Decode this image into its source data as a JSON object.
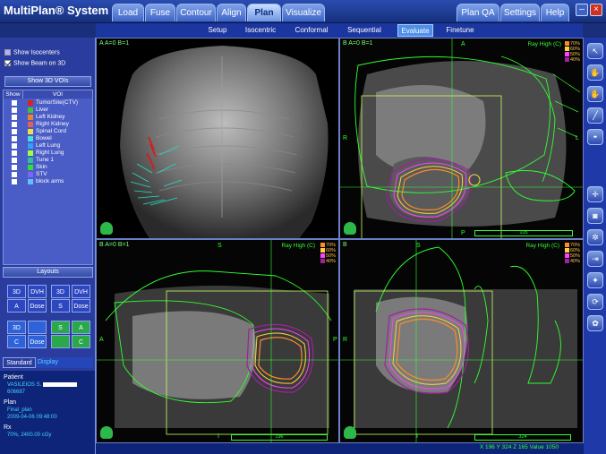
{
  "app": {
    "title": "MultiPlan® System"
  },
  "main_tabs": [
    "Load",
    "Fuse",
    "Contour",
    "Align",
    "Plan",
    "Visualize"
  ],
  "right_tabs": [
    "Plan QA",
    "Settings",
    "Help"
  ],
  "active_main_tab": "Plan",
  "sub_tabs": [
    "Setup",
    "Isocentric",
    "Conformal",
    "Sequential",
    "Evaluate",
    "Finetune"
  ],
  "active_sub_tab": "Evaluate",
  "left_panel": {
    "show_isocenters": "Show Isocenters",
    "show_beam_3d": "Show Beam on 3D",
    "show_3d_vois": "Show 3D VOIs",
    "voi_header_show": "Show",
    "voi_header_voi": "VOI",
    "vois": [
      {
        "name": "TumorSite(CTV)",
        "color": "#e02020"
      },
      {
        "name": "Liver",
        "color": "#40c040"
      },
      {
        "name": "Left Kidney",
        "color": "#f08030"
      },
      {
        "name": "Right Kidney",
        "color": "#e06060"
      },
      {
        "name": "Spinal Cord",
        "color": "#f0e040"
      },
      {
        "name": "Bowel",
        "color": "#40e0e0"
      },
      {
        "name": "Left Lung",
        "color": "#30a0ff"
      },
      {
        "name": "Right Lung",
        "color": "#a0ff40"
      },
      {
        "name": "Tune 1",
        "color": "#30c0a0"
      },
      {
        "name": "Skin",
        "color": "#30e030"
      },
      {
        "name": "STV",
        "color": "#8060ff"
      },
      {
        "name": "block arms",
        "color": "#60c0ff"
      }
    ],
    "layouts_label": "Layouts",
    "layout_buttons": [
      "3D",
      "DVH",
      "A",
      "Dose",
      "3D",
      "DVH",
      "S",
      "Dose",
      "3D",
      "A",
      "C",
      "Dose",
      "S",
      "C"
    ],
    "tabs": [
      "Standard",
      "Display"
    ],
    "patient_label": "Patient",
    "patient_name": "VASILEIOS S.",
    "patient_id": "606687",
    "plan_label": "Plan",
    "plan_name": "Final_plan",
    "plan_date": "2009-04-06 09:48:00",
    "rx_label": "Rx",
    "rx_value": "70%, 2400.00 cGy"
  },
  "viewports": {
    "tl": {
      "label": "A  A=0 B=1"
    },
    "tr": {
      "label": "B  A=0 B=1",
      "title": "Ray High (C)",
      "orient_top": "A",
      "orient_left": "R",
      "orient_bottom": "P",
      "slider": "105",
      "orient_right": "L"
    },
    "bl": {
      "label": "B  A=0 B=1",
      "title": "Ray High (C)",
      "orient_top": "S",
      "orient_left": "A",
      "orient_right": "P",
      "orient_bottom": "I",
      "slider": "196"
    },
    "br": {
      "label": "B",
      "title": "Ray High (C)",
      "orient_top": "S",
      "orient_left": "R",
      "orient_bottom": "I",
      "slider": "324"
    }
  },
  "legend": [
    {
      "label": "70%",
      "color": "#ff8a2a"
    },
    {
      "label": "60%",
      "color": "#ffd23a"
    },
    {
      "label": "50%",
      "color": "#ff40ff"
    },
    {
      "label": "40%",
      "color": "#a020a0"
    }
  ],
  "status": {
    "text": "X 196  Y 324  Z 165   Value 1050"
  },
  "tools": [
    {
      "name": "pointer-icon",
      "glyph": "↖"
    },
    {
      "name": "hand-icon",
      "glyph": "✋"
    },
    {
      "name": "hand-icon",
      "glyph": "✋"
    },
    {
      "name": "pen-icon",
      "glyph": "╱"
    },
    {
      "name": "half-circle-icon",
      "glyph": "◓"
    },
    {
      "name": "crosshair-icon",
      "glyph": "✛"
    },
    {
      "name": "camera-icon",
      "glyph": "◙"
    },
    {
      "name": "gear-icon",
      "glyph": "✲"
    },
    {
      "name": "export-icon",
      "glyph": "⇥"
    },
    {
      "name": "tool-icon",
      "glyph": "✦"
    },
    {
      "name": "rotate-icon",
      "glyph": "⟳"
    },
    {
      "name": "flower-icon",
      "glyph": "✿"
    }
  ]
}
